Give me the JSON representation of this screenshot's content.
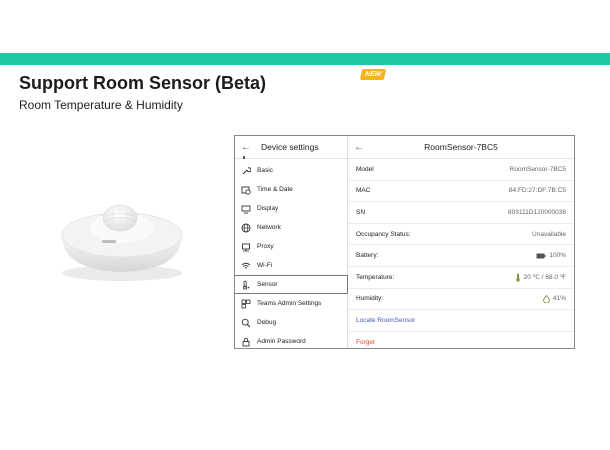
{
  "slide": {
    "title": "Support Room Sensor (Beta)",
    "subtitle": "Room Temperature & Humidity",
    "badge": "NEW",
    "accent_color": "#1ec8a5",
    "badge_color": "#f6b21c"
  },
  "device_settings": {
    "header": "Device settings",
    "back_icon": "arrow-left-icon",
    "items": [
      {
        "label": "Basic",
        "icon": "wrench-icon"
      },
      {
        "label": "Time & Date",
        "icon": "calendar-clock-icon"
      },
      {
        "label": "Display",
        "icon": "monitor-icon"
      },
      {
        "label": "Network",
        "icon": "globe-icon"
      },
      {
        "label": "Proxy",
        "icon": "proxy-icon"
      },
      {
        "label": "Wi-Fi",
        "icon": "wifi-icon"
      },
      {
        "label": "Sensor",
        "icon": "thermometer-icon",
        "selected": true
      },
      {
        "label": "Teams Admin Settings",
        "icon": "teams-grid-icon"
      },
      {
        "label": "Debug",
        "icon": "debug-search-icon"
      },
      {
        "label": "Admin Password",
        "icon": "lock-icon"
      }
    ]
  },
  "room_sensor": {
    "header": "RoomSensor-7BC5",
    "rows": [
      {
        "label": "Model",
        "value": "RoomSensor-7BC5"
      },
      {
        "label": "MAC",
        "value": "84:FD:27:DF:7B:C5"
      },
      {
        "label": "SN",
        "value": "803111D120000038"
      },
      {
        "label": "Occupancy Status:",
        "value": "Unavailable"
      },
      {
        "label": "Battery:",
        "value": "100%",
        "icon": "battery-icon"
      },
      {
        "label": "Temperature:",
        "value": "20 ℃ / 68.0 ℉",
        "icon": "thermometer-icon"
      },
      {
        "label": "Humidity:",
        "value": "41%",
        "icon": "droplet-icon"
      }
    ],
    "locate_label": "Locate RoomSensor",
    "forget_label": "Forget",
    "link_color": "#4a57b5",
    "danger_color": "#e2462a"
  }
}
